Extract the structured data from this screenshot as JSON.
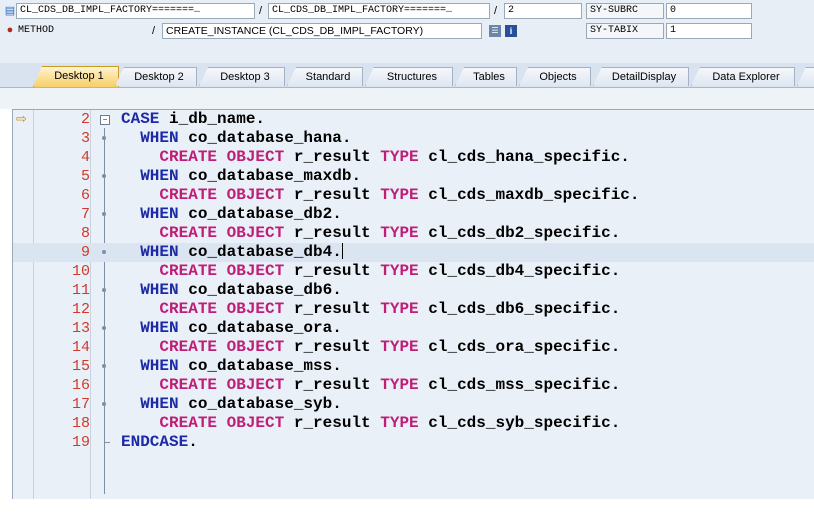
{
  "header": {
    "row1": {
      "program": "CL_CDS_DB_IMPL_FACTORY=======…",
      "sep1": "/",
      "include": "CL_CDS_DB_IMPL_FACTORY=======…",
      "sep2": "/",
      "line_no": "2",
      "var_name": "SY-SUBRC",
      "var_value": "0"
    },
    "row2": {
      "event_type": "METHOD",
      "sep": "/",
      "event": "CREATE_INSTANCE (CL_CDS_DB_IMPL_FACTORY)",
      "var_name": "SY-TABIX",
      "var_value": "1"
    }
  },
  "tabs": [
    {
      "label": "Desktop 1",
      "active": true
    },
    {
      "label": "Desktop 2"
    },
    {
      "label": "Desktop 3"
    },
    {
      "label": "Standard"
    },
    {
      "label": "Structures"
    },
    {
      "label": "Tables"
    },
    {
      "label": "Objects"
    },
    {
      "label": "DetailDisplay"
    },
    {
      "label": "Data Explorer"
    }
  ],
  "editor": {
    "lines": [
      {
        "no": "2",
        "parts": [
          [
            "kw",
            "CASE"
          ],
          [
            "id",
            " i_db_name."
          ]
        ]
      },
      {
        "no": "3",
        "parts": [
          [
            "kw",
            "  WHEN"
          ],
          [
            "id",
            " co_database_hana."
          ]
        ]
      },
      {
        "no": "4",
        "parts": [
          [
            "kw2",
            "    CREATE OBJECT"
          ],
          [
            "id",
            " r_result "
          ],
          [
            "kw2",
            "TYPE"
          ],
          [
            "id",
            " cl_cds_hana_specific."
          ]
        ]
      },
      {
        "no": "5",
        "parts": [
          [
            "kw",
            "  WHEN"
          ],
          [
            "id",
            " co_database_maxdb."
          ]
        ]
      },
      {
        "no": "6",
        "parts": [
          [
            "kw2",
            "    CREATE OBJECT"
          ],
          [
            "id",
            " r_result "
          ],
          [
            "kw2",
            "TYPE"
          ],
          [
            "id",
            " cl_cds_maxdb_specific."
          ]
        ]
      },
      {
        "no": "7",
        "parts": [
          [
            "kw",
            "  WHEN"
          ],
          [
            "id",
            " co_database_db2."
          ]
        ]
      },
      {
        "no": "8",
        "parts": [
          [
            "kw2",
            "    CREATE OBJECT"
          ],
          [
            "id",
            " r_result "
          ],
          [
            "kw2",
            "TYPE"
          ],
          [
            "id",
            " cl_cds_db2_specific."
          ]
        ]
      },
      {
        "no": "9",
        "parts": [
          [
            "kw",
            "  WHEN"
          ],
          [
            "id",
            " co_database_db4."
          ]
        ]
      },
      {
        "no": "10",
        "parts": [
          [
            "kw2",
            "    CREATE OBJECT"
          ],
          [
            "id",
            " r_result "
          ],
          [
            "kw2",
            "TYPE"
          ],
          [
            "id",
            " cl_cds_db4_specific."
          ]
        ]
      },
      {
        "no": "11",
        "parts": [
          [
            "kw",
            "  WHEN"
          ],
          [
            "id",
            " co_database_db6."
          ]
        ]
      },
      {
        "no": "12",
        "parts": [
          [
            "kw2",
            "    CREATE OBJECT"
          ],
          [
            "id",
            " r_result "
          ],
          [
            "kw2",
            "TYPE"
          ],
          [
            "id",
            " cl_cds_db6_specific."
          ]
        ]
      },
      {
        "no": "13",
        "parts": [
          [
            "kw",
            "  WHEN"
          ],
          [
            "id",
            " co_database_ora."
          ]
        ]
      },
      {
        "no": "14",
        "parts": [
          [
            "kw2",
            "    CREATE OBJECT"
          ],
          [
            "id",
            " r_result "
          ],
          [
            "kw2",
            "TYPE"
          ],
          [
            "id",
            " cl_cds_ora_specific."
          ]
        ]
      },
      {
        "no": "15",
        "parts": [
          [
            "kw",
            "  WHEN"
          ],
          [
            "id",
            " co_database_mss."
          ]
        ]
      },
      {
        "no": "16",
        "parts": [
          [
            "kw2",
            "    CREATE OBJECT"
          ],
          [
            "id",
            " r_result "
          ],
          [
            "kw2",
            "TYPE"
          ],
          [
            "id",
            " cl_cds_mss_specific."
          ]
        ]
      },
      {
        "no": "17",
        "parts": [
          [
            "kw",
            "  WHEN"
          ],
          [
            "id",
            " co_database_syb."
          ]
        ]
      },
      {
        "no": "18",
        "parts": [
          [
            "kw2",
            "    CREATE OBJECT"
          ],
          [
            "id",
            " r_result "
          ],
          [
            "kw2",
            "TYPE"
          ],
          [
            "id",
            " cl_cds_syb_specific."
          ]
        ]
      },
      {
        "no": "19",
        "parts": [
          [
            "kw",
            "ENDCASE"
          ],
          [
            "id",
            "."
          ]
        ]
      }
    ],
    "current_line": "2",
    "cursor_line": "9"
  },
  "colors": {
    "keyword": "#1c2aa8",
    "statement": "#bf1e78",
    "line_number": "#d03a2a"
  }
}
